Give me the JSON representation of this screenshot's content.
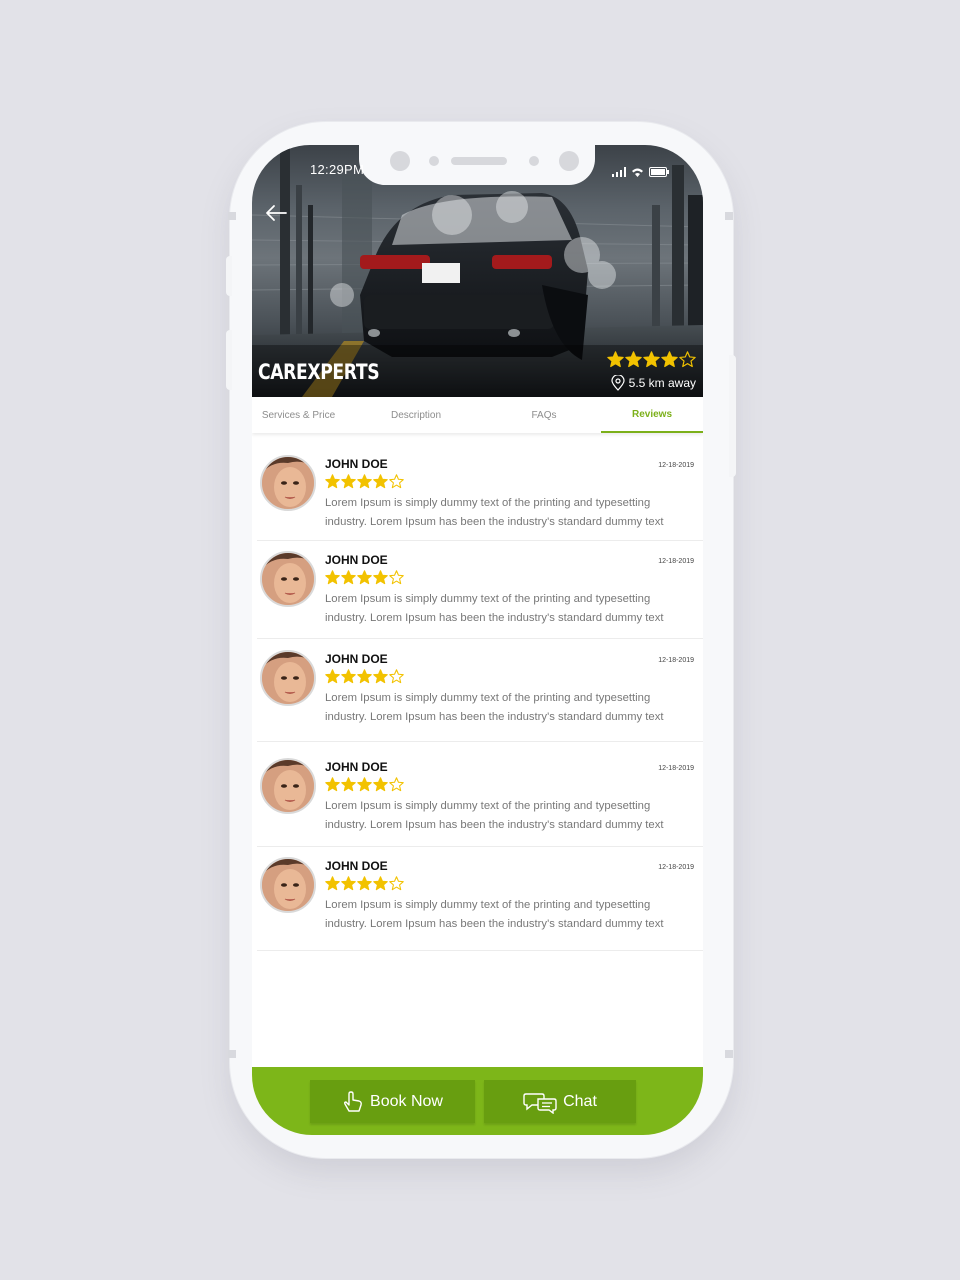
{
  "status_bar": {
    "time": "12:29PM"
  },
  "hero": {
    "business_name": "CAREXPERTS",
    "rating": 4,
    "rating_max": 5,
    "distance": "5.5 km away"
  },
  "tabs": [
    {
      "label": "Services & Price",
      "active": false
    },
    {
      "label": "Description",
      "active": false
    },
    {
      "label": "FAQs",
      "active": false
    },
    {
      "label": "Reviews",
      "active": true
    }
  ],
  "reviews": [
    {
      "name": "JOHN DOE",
      "date": "12-18-2019",
      "rating": 4,
      "line1": "Lorem Ipsum is simply dummy text of the printing and typesetting",
      "line2": "industry. Lorem Ipsum has been the industry's standard dummy text"
    },
    {
      "name": "JOHN DOE",
      "date": "12-18-2019",
      "rating": 4,
      "line1": "Lorem Ipsum is simply dummy text of the printing and typesetting",
      "line2": "industry. Lorem Ipsum has been the industry's standard dummy text"
    },
    {
      "name": "JOHN DOE",
      "date": "12-18-2019",
      "rating": 4,
      "line1": "Lorem Ipsum is simply dummy text of the printing and typesetting",
      "line2": "industry. Lorem Ipsum has been the industry's standard dummy text"
    },
    {
      "name": "JOHN DOE",
      "date": "12-18-2019",
      "rating": 4,
      "line1": "Lorem Ipsum is simply dummy text of the printing and typesetting",
      "line2": "industry. Lorem Ipsum has been the industry's standard dummy text"
    },
    {
      "name": "JOHN DOE",
      "date": "12-18-2019",
      "rating": 4,
      "line1": "Lorem Ipsum is simply dummy text of the printing and typesetting",
      "line2": "industry. Lorem Ipsum has been the industry's standard dummy text"
    }
  ],
  "actions": {
    "book_label": "Book Now",
    "chat_label": "Chat"
  },
  "icons": {
    "back": "arrow-left-icon",
    "location": "location-pin-icon",
    "star": "star-icon",
    "book": "tap-hand-icon",
    "chat": "chat-bubbles-icon"
  },
  "colors": {
    "accent": "#7cb01a",
    "bottom_bar": "#7db619",
    "button": "#689e10",
    "star": "#f2c200",
    "background": "#e2e2e8"
  }
}
